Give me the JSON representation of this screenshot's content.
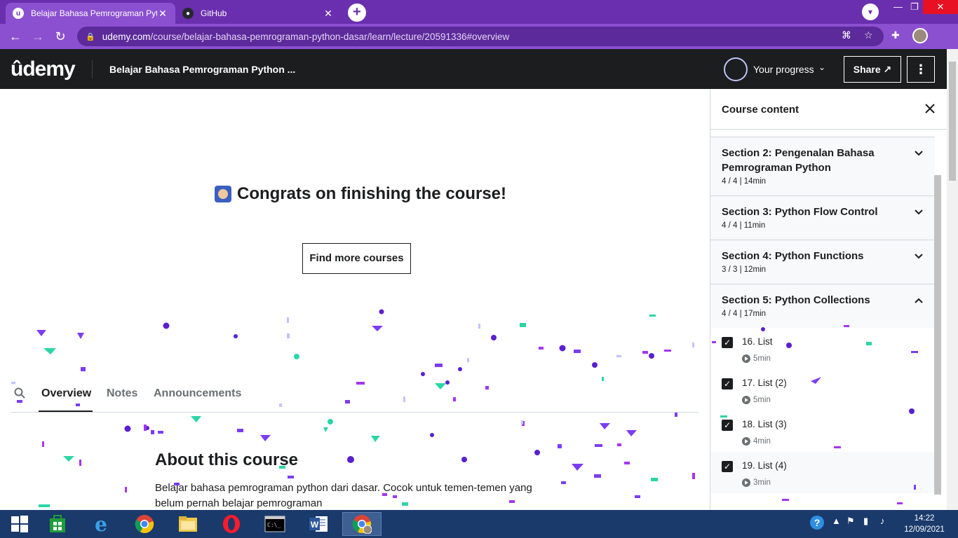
{
  "browser": {
    "tabs": [
      {
        "title": "Belajar Bahasa Pemrograman Pyt",
        "active": true
      },
      {
        "title": "GitHub",
        "active": false
      }
    ],
    "url_host": "udemy.com",
    "url_path": "/course/belajar-bahasa-pemrograman-python-dasar/learn/lecture/20591336#overview"
  },
  "header": {
    "logo": "ûdemy",
    "course_title": "Belajar Bahasa Pemrograman Python ...",
    "progress_label": "Your progress",
    "share_label": "Share ↗"
  },
  "main": {
    "congrats": "Congrats on finishing the course!",
    "find_courses": "Find more courses",
    "tabs": [
      "Overview",
      "Notes",
      "Announcements"
    ],
    "about_title": "About this course",
    "about_text": "Belajar bahasa pemrograman python dari dasar. Cocok untuk temen-temen yang belum pernah belajar pemrograman"
  },
  "sidebar": {
    "title": "Course content",
    "sections": [
      {
        "name": "Section 2: Pengenalan Bahasa Pemrograman Python",
        "meta": "4 / 4 | 14min",
        "expanded": false
      },
      {
        "name": "Section 3: Python Flow Control",
        "meta": "4 / 4 | 11min",
        "expanded": false
      },
      {
        "name": "Section 4: Python Functions",
        "meta": "3 / 3 | 12min",
        "expanded": false
      },
      {
        "name": "Section 5: Python Collections",
        "meta": "4 / 4 | 17min",
        "expanded": true
      }
    ],
    "lectures": [
      {
        "name": "16. List",
        "duration": "5min"
      },
      {
        "name": "17. List (2)",
        "duration": "5min"
      },
      {
        "name": "18. List (3)",
        "duration": "4min"
      },
      {
        "name": "19. List (4)",
        "duration": "3min"
      }
    ]
  },
  "taskbar": {
    "time": "14:22",
    "date": "12/09/2021"
  },
  "colors": {
    "chrome_tabbar": "#6a2fae",
    "chrome_toolbar": "#8b50d0",
    "udemy_header": "#1c1d1f",
    "confetti_purple": "#7c3cf5",
    "confetti_violet": "#a435f0",
    "confetti_teal": "#2bd6a6",
    "taskbar": "#1a3a6b"
  }
}
